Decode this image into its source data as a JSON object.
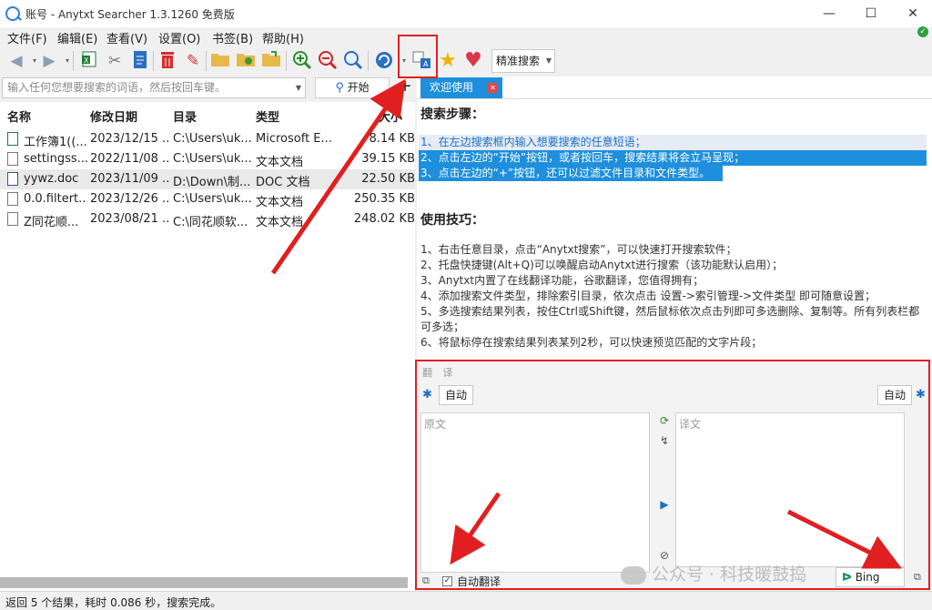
{
  "window": {
    "title": "账号 - Anytxt Searcher 1.3.1260 免费版",
    "minimize": "—",
    "maximize": "☐",
    "close": "✕"
  },
  "menu": [
    "文件(F)",
    "编辑(E)",
    "查看(V)",
    "设置(O)",
    "书签(B)",
    "帮助(H)"
  ],
  "toolbar": {
    "icons": [
      "back-arrow-icon",
      "forward-arrow-icon",
      "excel-icon",
      "scissors-icon",
      "document-icon",
      "delete-bin-icon",
      "broom-icon",
      "folder-icon",
      "open-folder-icon",
      "folder-export-icon",
      "zoom-in-icon",
      "zoom-out-icon",
      "search-icon",
      "refresh-icon",
      "translate-icon",
      "star-icon",
      "heart-icon"
    ],
    "search_mode": "精准搜索"
  },
  "search": {
    "placeholder": "输入任何您想要搜索的词语，然后按回车键。",
    "start_label": "开始",
    "plus_label": "+"
  },
  "table": {
    "headers": [
      "名称",
      "修改日期",
      "目录",
      "类型",
      "大小"
    ],
    "rows": [
      {
        "name": "工作簿1((...",
        "date": "2023/12/15 ...",
        "dir": "C:\\Users\\uk...",
        "type": "Microsoft E...",
        "size": "8.14 KB"
      },
      {
        "name": "settingss...",
        "date": "2022/11/08 ...",
        "dir": "C:\\Users\\uk...",
        "type": "文本文档",
        "size": "39.15 KB"
      },
      {
        "name": "yywz.doc",
        "date": "2023/11/09 ...",
        "dir": "D:\\Down\\制...",
        "type": "DOC 文档",
        "size": "22.50 KB"
      },
      {
        "name": "0.0.filtert...",
        "date": "2023/12/26 ...",
        "dir": "C:\\Users\\uk...",
        "type": "文本文档",
        "size": "250.35 KB"
      },
      {
        "name": "Z同花顺...",
        "date": "2023/08/21 ...",
        "dir": "C:\\同花顺软...",
        "type": "文本文档",
        "size": "248.02 KB"
      }
    ]
  },
  "welcome": {
    "tab_label": "欢迎使用",
    "steps_title": "搜索步骤：",
    "steps": [
      "1、在左边搜索框内输入想要搜索的任意短语；",
      "2、点击左边的“开始”按钮，或者按回车，搜索结果将会立马呈现；",
      "3、点击左边的“+”按钮，还可以过滤文件目录和文件类型。"
    ],
    "tips_title": "使用技巧：",
    "tips": [
      "1、右击任意目录，点击“Anytxt搜索”，可以快速打开搜索软件；",
      "2、托盘快捷键(Alt+Q)可以唤醒启动Anytxt进行搜索（该功能默认启用）；",
      "3、Anytxt内置了在线翻译功能，谷歌翻译，您值得拥有；",
      "4、添加搜索文件类型，排除索引目录，依次点击 设置->索引管理->文件类型 即可随意设置；",
      "5、多选搜索结果列表，按住Ctrl或Shift键，然后鼠标依次点击列即可多选删除、复制等。所有列表栏都可多选；",
      "6、将鼠标停在搜索结果列表某列2秒，可以快速预览匹配的文字片段；",
      "......"
    ]
  },
  "translate": {
    "title": "翻 译",
    "src_lang": "自动",
    "dst_lang": "自动",
    "src_placeholder": "原文",
    "dst_placeholder": "译文",
    "auto_translate_label": "自动翻译",
    "auto_translate_checked": true,
    "engine": "Bing"
  },
  "status": {
    "text": "返回 5 个结果，耗时 0.086 秒，搜索完成。"
  },
  "watermark": "公众号 · 科技暖鼓捣",
  "colors": {
    "accent": "#1e8fdc",
    "annotation": "#e02020"
  }
}
